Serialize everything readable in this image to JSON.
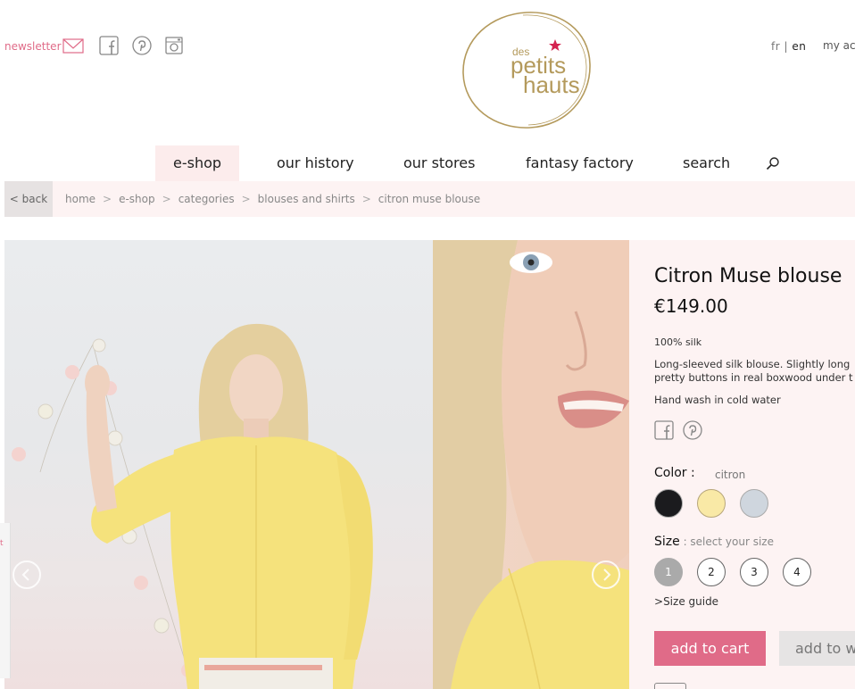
{
  "header": {
    "newsletter_label": "newsletter",
    "logo": {
      "line1": "des",
      "line2": "petits",
      "line3": "hauts"
    },
    "lang_fr": "fr",
    "lang_sep": "|",
    "lang_en": "en",
    "account_label": "my ac"
  },
  "nav": {
    "items": [
      "e-shop",
      "our history",
      "our stores",
      "fantasy factory",
      "search"
    ]
  },
  "breadcrumb": {
    "back": "< back",
    "items": [
      "home",
      "e-shop",
      "categories",
      "blouses and shirts",
      "citron muse blouse"
    ],
    "sep": ">"
  },
  "side_tab_text": "t",
  "product": {
    "title": "Citron Muse blouse",
    "price": "€149.00",
    "material": "100% silk",
    "description_line1": "Long-sleeved silk blouse. Slightly long",
    "description_line2": "pretty buttons in real boxwood under t",
    "care": "Hand wash in cold water",
    "color_label": "Color :",
    "color_value": "citron",
    "colors": [
      "#1b1b1e",
      "#f9e9a6",
      "#cfd6de"
    ],
    "size_label": "Size",
    "size_hint": " : select your size",
    "sizes": [
      "1",
      "2",
      "3",
      "4"
    ],
    "selected_size": "1",
    "size_guide": "Size guide",
    "size_guide_prefix": ">",
    "add_to_cart": "add to cart",
    "add_to_wishlist": "add to w"
  },
  "colors": {
    "accent": "#e06b88",
    "panel_bg": "#fdf3f3",
    "nav_active_bg": "#fcecec"
  }
}
